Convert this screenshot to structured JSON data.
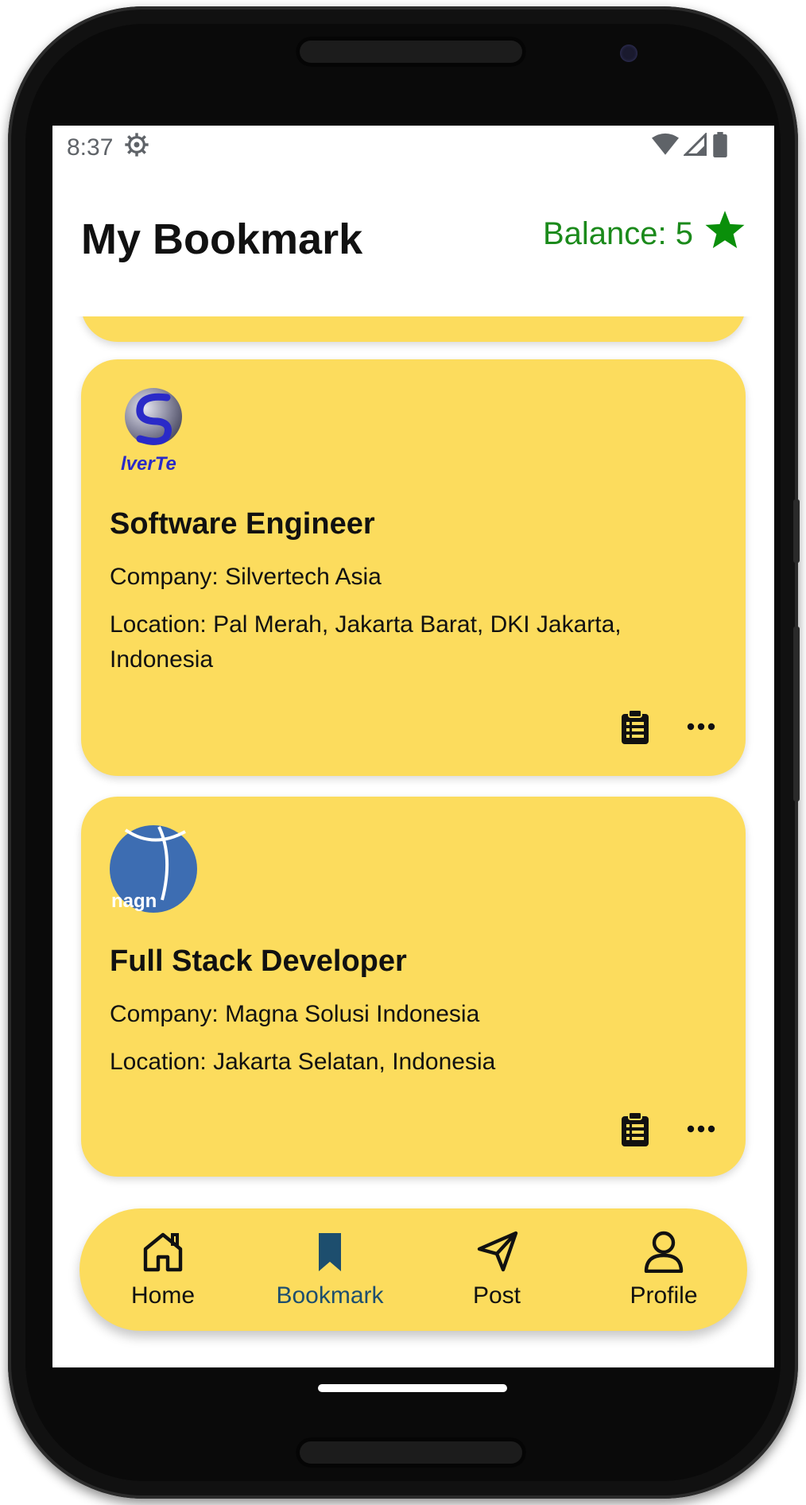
{
  "status": {
    "time": "8:37"
  },
  "header": {
    "title": "My Bookmark",
    "balance": "Balance: 5"
  },
  "jobs": [
    {
      "title": "Software Engineer",
      "company": "Company: Silvertech Asia",
      "location": "Location: Pal Merah, Jakarta Barat, DKI Jakarta, Indonesia",
      "logo_text": "lverTe"
    },
    {
      "title": "Full Stack Developer",
      "company": "Company: Magna Solusi Indonesia",
      "location": "Location: Jakarta Selatan, Indonesia",
      "logo_text": "nagn"
    }
  ],
  "nav": {
    "items": [
      {
        "label": "Home",
        "icon": "home-icon"
      },
      {
        "label": "Bookmark",
        "icon": "bookmark-icon"
      },
      {
        "label": "Post",
        "icon": "send-icon"
      },
      {
        "label": "Profile",
        "icon": "person-icon"
      }
    ],
    "active": "Bookmark"
  },
  "colors": {
    "card": "#fcdc5d",
    "balance": "#1b8a1b",
    "active_nav": "#1d4e6e"
  }
}
